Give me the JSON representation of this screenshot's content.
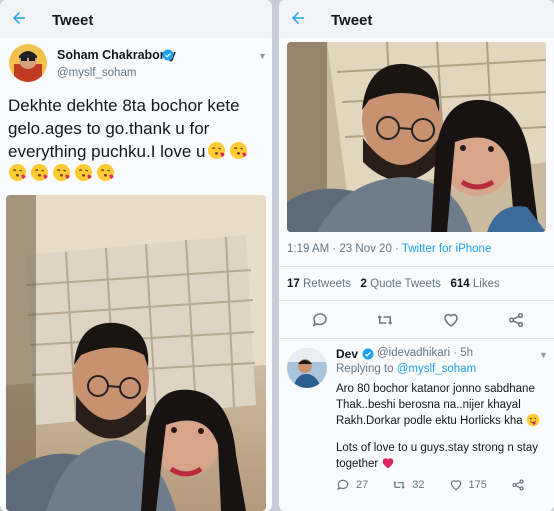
{
  "left": {
    "header": {
      "title": "Tweet"
    },
    "author": {
      "name": "Soham Chakraborty",
      "handle": "@myslf_soham"
    },
    "tweet": {
      "text": "Dekhte dekhte 8ta bochor kete gelo.ages to go.thank u for everything puchku.I love u",
      "emojis": [
        "kiss-emoji",
        "kiss-emoji",
        "kiss-emoji",
        "kiss-emoji",
        "kiss-emoji",
        "kiss-emoji",
        "kiss-emoji"
      ]
    }
  },
  "right": {
    "header": {
      "title": "Tweet"
    },
    "meta": {
      "time": "1:19 AM · 23 Nov 20 · ",
      "source": "Twitter for iPhone"
    },
    "stats": {
      "retweets_count": "17",
      "retweets_label": "Retweets",
      "quotes_count": "2",
      "quotes_label": "Quote Tweets",
      "likes_count": "614",
      "likes_label": "Likes"
    },
    "actions": [
      "reply-icon",
      "retweet-icon",
      "like-icon",
      "share-icon"
    ],
    "reply": {
      "name": "Dev",
      "handle": "@idevadhikari",
      "time": "· 5h",
      "replying_prefix": "Replying to ",
      "replying_to": "@myslf_soham",
      "text1": "Aro 80 bochor katanor jonno sabdhane Thak..beshi berosna na..nijer khayal Rakh.Dorkar podle ektu Horlicks kha",
      "text2": "Lots of love to u guys.stay strong n stay together",
      "reply_count": "27",
      "retweet_count": "32",
      "like_count": "175"
    }
  },
  "colors": {
    "accent": "#1da1f2",
    "heart": "#e0245e",
    "muted": "#657786"
  }
}
